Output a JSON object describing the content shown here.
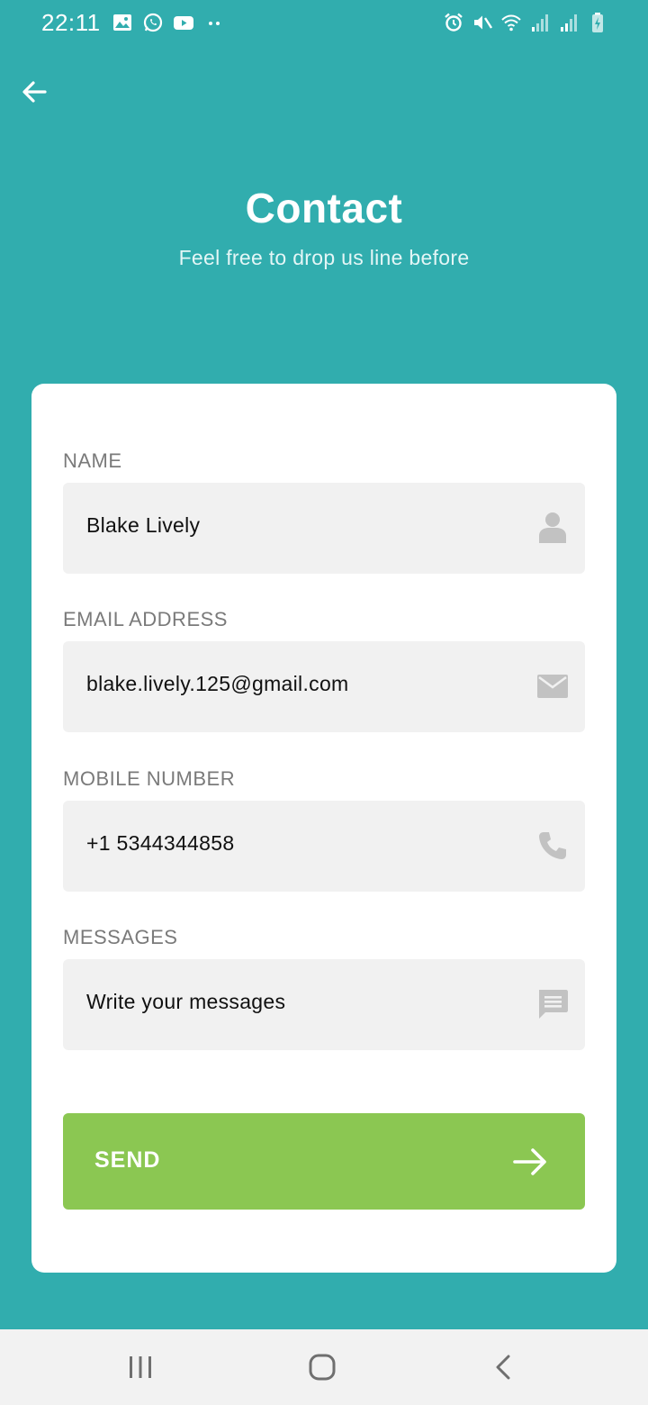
{
  "status_bar": {
    "time": "22:11",
    "left_icons": [
      "image-icon",
      "whatsapp-icon",
      "youtube-icon",
      "more-dots-icon"
    ],
    "right_icons": [
      "alarm-icon",
      "mute-icon",
      "wifi-icon",
      "signal-icon",
      "signal-icon",
      "battery-charging-icon"
    ]
  },
  "header": {
    "title": "Contact",
    "subtitle": "Feel free to drop us line before"
  },
  "form": {
    "name": {
      "label": "NAME",
      "value": "Blake Lively",
      "icon": "person-icon"
    },
    "email": {
      "label": "EMAIL ADDRESS",
      "value": "blake.lively.125@gmail.com",
      "icon": "mail-icon"
    },
    "mobile": {
      "label": "MOBILE NUMBER",
      "value": "+1 5344344858",
      "icon": "phone-icon"
    },
    "messages": {
      "label": "MESSAGES",
      "placeholder": "Write your messages",
      "icon": "message-icon"
    },
    "send_label": "SEND"
  },
  "colors": {
    "background": "#31adae",
    "card": "#ffffff",
    "field": "#f1f1f1",
    "send_button": "#8bc752",
    "label": "#7a7a7a",
    "icon": "#c2c2c2"
  }
}
